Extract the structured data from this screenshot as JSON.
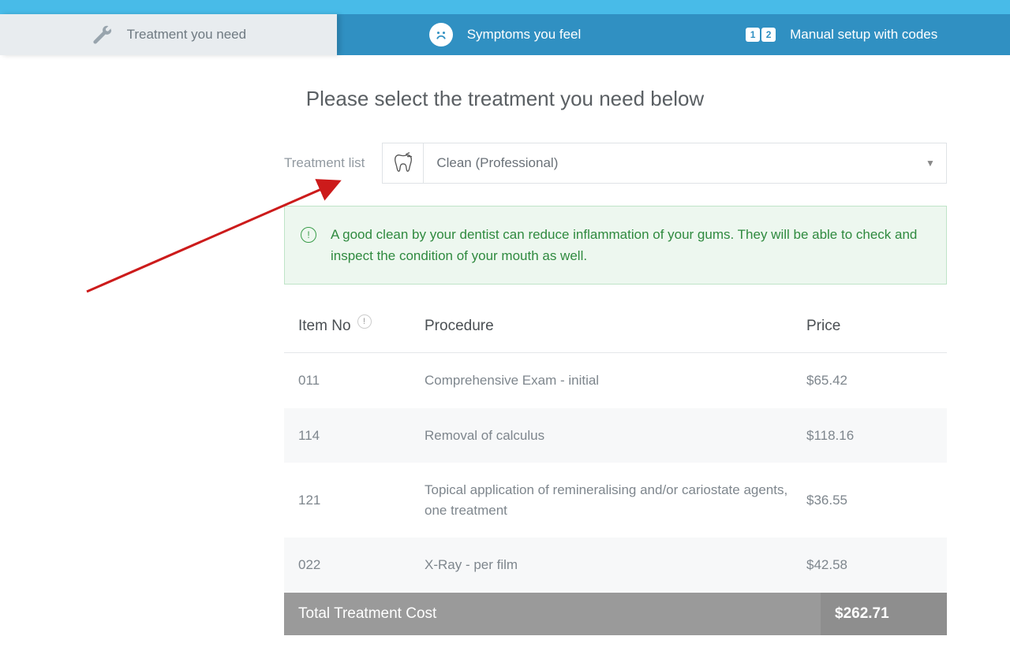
{
  "tabs": {
    "treatment": "Treatment you need",
    "symptoms": "Symptoms you feel",
    "manual": "Manual setup with codes"
  },
  "heading": "Please select the treatment you need below",
  "treatment_label": "Treatment list",
  "dropdown": {
    "selected": "Clean (Professional)"
  },
  "note": "A good clean by your dentist can reduce inflammation of your gums. They will be able to check and inspect the condition of your mouth as well.",
  "table": {
    "headers": {
      "item": "Item No",
      "procedure": "Procedure",
      "price": "Price"
    },
    "rows": [
      {
        "item": "011",
        "procedure": "Comprehensive Exam - initial",
        "price": "$65.42"
      },
      {
        "item": "114",
        "procedure": "Removal of calculus",
        "price": "$118.16"
      },
      {
        "item": "121",
        "procedure": "Topical application of remineralising and/or cariostate agents, one treatment",
        "price": "$36.55"
      },
      {
        "item": "022",
        "procedure": "X-Ray - per film",
        "price": "$42.58"
      }
    ],
    "total_label": "Total Treatment Cost",
    "total_value": "$262.71"
  }
}
